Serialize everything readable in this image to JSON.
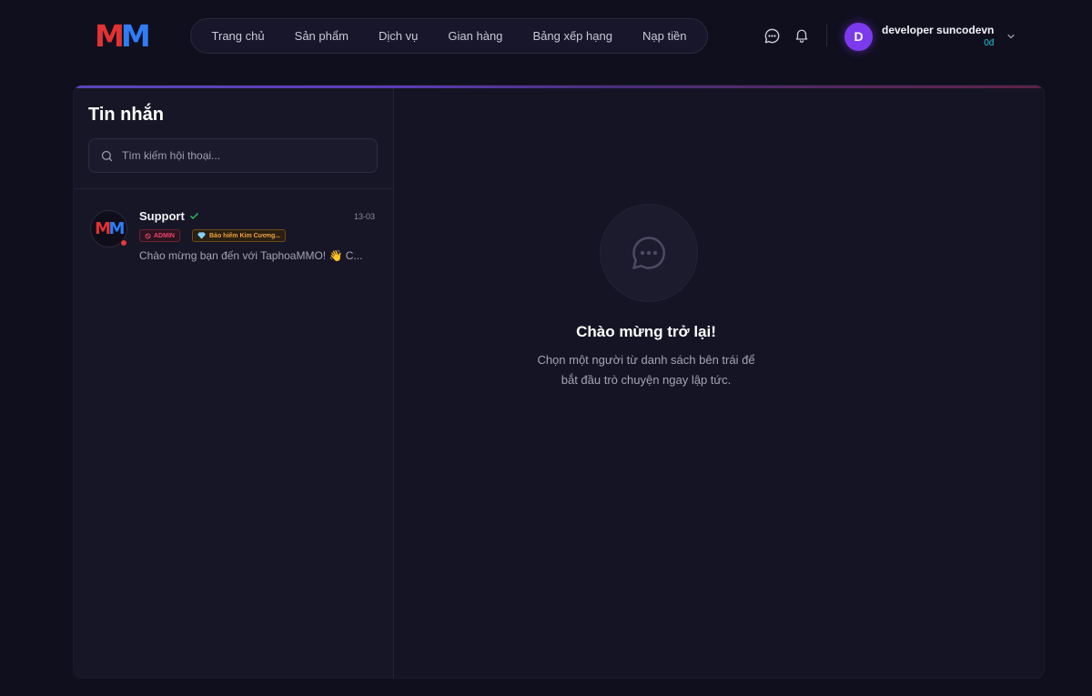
{
  "header": {
    "logo": {
      "m1": "M",
      "m2": "M"
    },
    "nav": [
      {
        "label": "Trang chủ"
      },
      {
        "label": "Sản phẩm"
      },
      {
        "label": "Dịch vụ"
      },
      {
        "label": "Gian hàng"
      },
      {
        "label": "Bảng xếp hạng"
      },
      {
        "label": "Nạp tiền"
      }
    ],
    "icons": [
      "chat-icon",
      "bell-icon"
    ],
    "user": {
      "avatar_letter": "D",
      "name": "developer suncodevn",
      "balance": "0đ",
      "avatar_color": "#7c3aed"
    }
  },
  "sidebar": {
    "title": "Tin nhắn",
    "search_placeholder": "Tìm kiếm hội thoại...",
    "conversations": [
      {
        "name": "Support",
        "verified": true,
        "time": "13-03",
        "badge_admin": "ADMIN",
        "badge_insurance": "Bảo hiểm Kim Cương...",
        "preview": "Chào mừng bạn đến với TaphoaMMO! 👋 C...",
        "online_dot_color": "#e23a3a"
      }
    ]
  },
  "main": {
    "title": "Chào mừng trở lại!",
    "subtitle_line1": "Chọn một người từ danh sách bên trái để",
    "subtitle_line2": "bắt đầu trò chuyện ngay lập tức."
  },
  "colors": {
    "background": "#100f1e",
    "panel": "#151424",
    "accent_red": "#e23232",
    "accent_blue": "#2f7df6",
    "balance": "#22c7d6"
  }
}
